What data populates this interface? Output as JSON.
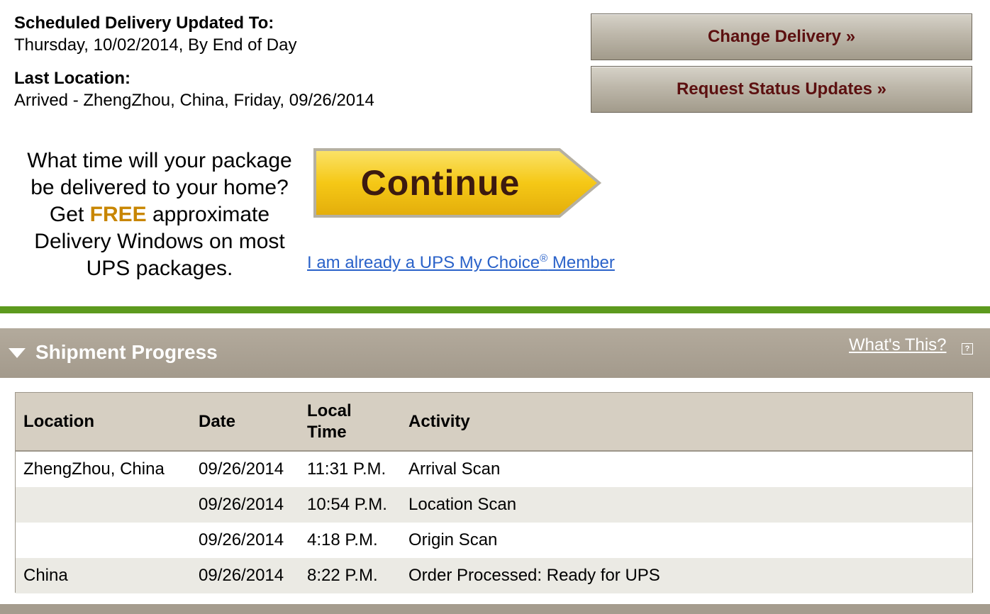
{
  "delivery": {
    "scheduled_label": "Scheduled Delivery Updated To:",
    "scheduled_value": "Thursday, 10/02/2014, By End of Day",
    "last_location_label": "Last Location:",
    "last_location_value": "Arrived - ZhengZhou, China, Friday, 09/26/2014"
  },
  "actions": {
    "change_delivery": "Change Delivery »",
    "request_updates": "Request Status Updates »"
  },
  "promo": {
    "line1": "What time will your package",
    "line2": "be delivered to your home?",
    "line3_pre": "Get ",
    "line3_free": "FREE",
    "line3_post": " approximate",
    "line4": "Delivery Windows on most",
    "line5": "UPS packages.",
    "continue_label": "Continue",
    "member_link_pre": "I am already a UPS My Choice",
    "member_link_reg": "®",
    "member_link_post": " Member"
  },
  "progress": {
    "title": "Shipment Progress",
    "whats_this": "What's This?",
    "help_icon": "?",
    "columns": [
      "Location",
      "Date",
      "Local Time",
      "Activity"
    ],
    "rows": [
      {
        "location": "ZhengZhou, China",
        "date": "09/26/2014",
        "time": "11:31 P.M.",
        "activity": "Arrival Scan"
      },
      {
        "location": "",
        "date": "09/26/2014",
        "time": "10:54 P.M.",
        "activity": "Location Scan"
      },
      {
        "location": "",
        "date": "09/26/2014",
        "time": "4:18 P.M.",
        "activity": "Origin Scan"
      },
      {
        "location": "China",
        "date": "09/26/2014",
        "time": "8:22 P.M.",
        "activity": "Order Processed: Ready for UPS"
      }
    ]
  },
  "colors": {
    "accent_green": "#5d9a1e",
    "header_tan": "#a39a8c",
    "button_text": "#5c1010",
    "free_text": "#c88600",
    "link_blue": "#2a62c9",
    "continue_yellow": "#f5c816"
  }
}
